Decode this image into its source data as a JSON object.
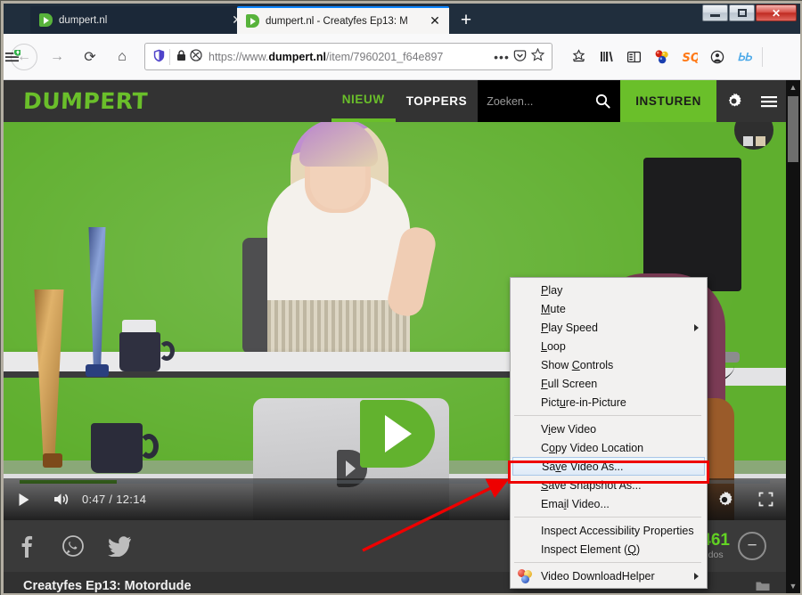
{
  "window": {
    "controls": {
      "minimize": "–",
      "maximize": "□",
      "close": "✕"
    }
  },
  "browser": {
    "tabs": [
      {
        "title": "dumpert.nl",
        "favicon": "dumpert-play-icon",
        "close": "✕",
        "active": false
      },
      {
        "title": "dumpert.nl - Creatyfes Ep13: M",
        "favicon": "dumpert-play-icon",
        "close": "✕",
        "active": true
      }
    ],
    "new_tab_label": "+",
    "nav": {
      "back": "←",
      "forward": "→",
      "reload": "⟳",
      "home": "⌂"
    },
    "urlbar": {
      "shield_icon": "🛡",
      "lock_icon": "🔒",
      "reader_icon": "◎",
      "url_prefix": "https://www.",
      "url_domain": "dumpert.nl",
      "url_path": "/item/7960201_f64e897",
      "page_actions": "•••",
      "pocket_icon": "▽",
      "bookmark_icon": "☆"
    },
    "extensions": [
      {
        "name": "screenshot-icon",
        "glyph": "⛨"
      },
      {
        "name": "library-icon",
        "glyph": "❙❙❙\\"
      },
      {
        "name": "sidebar-icon",
        "glyph": "▣"
      },
      {
        "name": "video-downloadhelper-icon",
        "glyph": ""
      },
      {
        "name": "stylus-icon",
        "glyph": "SQ"
      },
      {
        "name": "account-icon",
        "glyph": "☻"
      },
      {
        "name": "wappalyzer-icon",
        "glyph": "ᏏᏏ"
      }
    ],
    "menu_icon": "☰"
  },
  "site": {
    "logo": "DUMPERT",
    "nav": [
      {
        "label": "NIEUW",
        "active": true
      },
      {
        "label": "TOPPERS",
        "active": false
      }
    ],
    "search": {
      "placeholder": "Zoeken...",
      "icon": "search-icon"
    },
    "submit_button": "INSTUREN",
    "settings_icon": "gear-icon",
    "menu_icon": "hamburger-icon"
  },
  "player": {
    "big_play_icon": "dumpert-play-button",
    "progress_percent": 13,
    "play_icon": "▶",
    "volume_icon": "🔊",
    "current_time": "0:47",
    "separator": "/",
    "duration": "12:14",
    "time_display": "0:47 / 12:14",
    "settings_icon": "gear-icon",
    "fullscreen_icon": "fullscreen-icon"
  },
  "social": {
    "items": [
      {
        "name": "facebook-icon",
        "glyph": "f"
      },
      {
        "name": "whatsapp-icon",
        "glyph": "✆"
      },
      {
        "name": "twitter-icon",
        "glyph": "🐦"
      }
    ],
    "kudos": {
      "plus": "+",
      "count": "+461",
      "label": "kudos",
      "minus": "−"
    }
  },
  "video_title": "Creatyfes Ep13: Motordude",
  "folder_icon": "folder-icon",
  "context_menu": {
    "items": [
      {
        "label": "Play",
        "accel_index": 0,
        "type": "item"
      },
      {
        "label": "Mute",
        "accel_index": 0,
        "type": "item"
      },
      {
        "label": "Play Speed",
        "accel_index": 0,
        "type": "submenu"
      },
      {
        "label": "Loop",
        "accel_index": 0,
        "type": "item"
      },
      {
        "label": "Show Controls",
        "accel_index": 5,
        "type": "item"
      },
      {
        "label": "Full Screen",
        "accel_index": 0,
        "type": "item"
      },
      {
        "label": "Picture-in-Picture",
        "accel_index": 4,
        "type": "item"
      },
      {
        "type": "separator"
      },
      {
        "label": "View Video",
        "accel_index": 1,
        "type": "item"
      },
      {
        "label": "Copy Video Location",
        "accel_index": 1,
        "type": "item"
      },
      {
        "label": "Save Video As...",
        "accel_index": 2,
        "type": "item",
        "selected": true
      },
      {
        "label": "Save Snapshot As...",
        "accel_index": 0,
        "type": "item"
      },
      {
        "label": "Email Video...",
        "accel_index": 3,
        "type": "item"
      },
      {
        "type": "separator"
      },
      {
        "label": "Inspect Accessibility Properties",
        "type": "item"
      },
      {
        "label": "Inspect Element (Q)",
        "type": "item"
      },
      {
        "type": "separator"
      },
      {
        "label": "Video DownloadHelper",
        "type": "submenu",
        "icon": "vdh-balls-icon"
      }
    ]
  },
  "annotation": {
    "highlight_target": "Save Video As...",
    "highlight_color": "#ee0000",
    "arrow_color": "#ee0000"
  },
  "colors": {
    "brand_green": "#6abf2a",
    "kudos_green": "#63d424",
    "header_dark": "#333333",
    "annotation_red": "#ee0000"
  }
}
